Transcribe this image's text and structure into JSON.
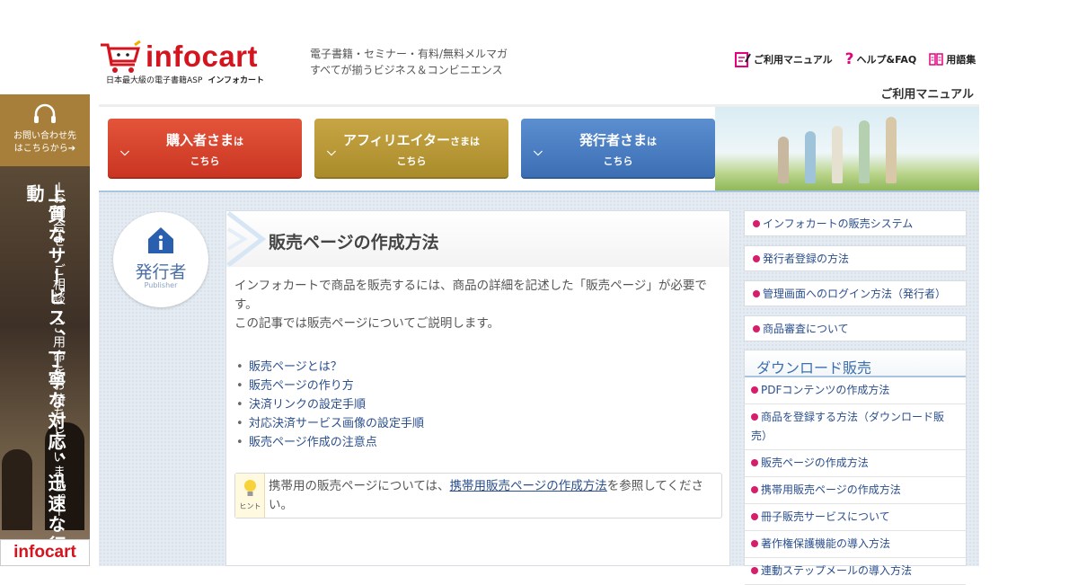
{
  "header": {
    "logo_text": "infocart",
    "logo_sub_left": "日本最大級の電子書籍ASP",
    "logo_sub_right": "インフォカート",
    "tagline": [
      "電子書籍・セミナー・有料/無料メルマガ",
      "すべてが揃うビジネス＆コンビニエンス"
    ],
    "top_links": [
      {
        "label": "ご利用マニュアル",
        "icon": "manual-icon"
      },
      {
        "label": "ヘルプ&FAQ",
        "icon": "question-icon"
      },
      {
        "label": "用語集",
        "icon": "glossary-icon"
      }
    ],
    "page_label": "ご利用マニュアル"
  },
  "side_banner": {
    "contact_line1": "お問い合わせ先",
    "contact_line2": "はこちらから➔",
    "headline": "上質なサービス、丁寧な対応、迅速な行動",
    "subline": "─お問合せ・ご相談・ご用命をお待ちしています。─",
    "logo_text": "infocart"
  },
  "nav": {
    "buyer": {
      "main": "購入者さま",
      "suffix": "は",
      "line2": "こちら"
    },
    "affiliate": {
      "main": "アフィリエイター",
      "suffix": "さまは",
      "line2": "こちら"
    },
    "publisher": {
      "main": "発行者さま",
      "suffix": "は",
      "line2": "こちら"
    }
  },
  "badge": {
    "jp": "発行者",
    "en": "Publisher"
  },
  "content": {
    "title": "販売ページの作成方法",
    "intro": [
      "インフォカートで商品を販売するには、商品の詳細を記述した「販売ページ」が必要です。",
      "この記事では販売ページについてご説明します。"
    ],
    "toc": [
      "販売ページとは？",
      "販売ページの作り方",
      "決済リンクの設定手順",
      "対応決済サービス画像の設定手順",
      "販売ページ作成の注意点"
    ],
    "hint": {
      "label": "ヒント",
      "before": "携帯用の販売ページについては、",
      "link": "携帯用販売ページの作成方法",
      "after": "を参照してください。"
    }
  },
  "sidebar": {
    "links": [
      "インフォカートの販売システム",
      "発行者登録の方法",
      "管理画面へのログイン方法（発行者）",
      "商品審査について"
    ],
    "download": {
      "title": "ダウンロード販売",
      "items": [
        "PDFコンテンツの作成方法",
        "商品を登録する方法（ダウンロード販売）",
        "販売ページの作成方法",
        "携帯用販売ページの作成方法",
        "冊子販売サービスについて",
        "著作権保護機能の導入方法",
        "連動ステップメールの導入方法"
      ]
    }
  },
  "colors": {
    "brand_red": "#d4141e",
    "link_blue": "#2b4f8c",
    "bullet_pink": "#d51f6c"
  }
}
